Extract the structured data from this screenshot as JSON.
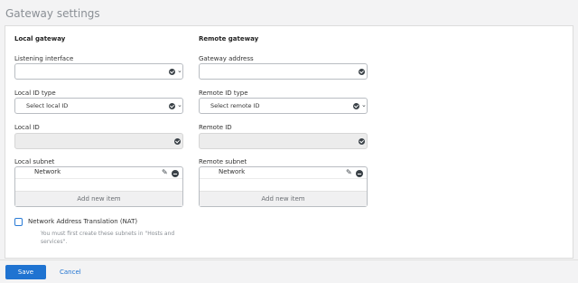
{
  "page": {
    "title": "Gateway settings"
  },
  "local": {
    "heading": "Local gateway",
    "listening_interface": {
      "label": "Listening interface",
      "value": ""
    },
    "id_type": {
      "label": "Local ID type",
      "value": "Select local ID"
    },
    "id": {
      "label": "Local ID",
      "value": ""
    },
    "subnet": {
      "label": "Local subnet",
      "items": [
        "Network"
      ],
      "add_label": "Add new item"
    }
  },
  "remote": {
    "heading": "Remote gateway",
    "address": {
      "label": "Gateway address",
      "value": ""
    },
    "id_type": {
      "label": "Remote ID type",
      "value": "Select remote ID"
    },
    "id": {
      "label": "Remote ID",
      "value": ""
    },
    "subnet": {
      "label": "Remote subnet",
      "items": [
        "Network"
      ],
      "add_label": "Add new item"
    }
  },
  "nat": {
    "label": "Network Address Translation (NAT)",
    "checked": false,
    "hint": "You must first create these subnets in \"Hosts and services\"."
  },
  "footer": {
    "save_label": "Save",
    "cancel_label": "Cancel"
  },
  "colors": {
    "primary": "#1f73d1",
    "icon": "#3a4147",
    "border": "#b9bdc2"
  }
}
